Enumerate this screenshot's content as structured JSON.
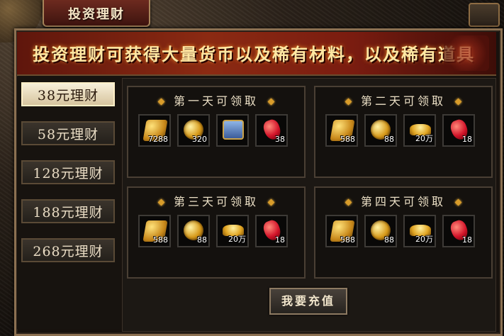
{
  "window": {
    "title": "投资理财"
  },
  "banner": {
    "text": "投资理财可获得大量货币以及稀有材料，以及稀有道具"
  },
  "sidebar": {
    "items": [
      {
        "label": "38元理财",
        "active": true
      },
      {
        "label": "58元理财",
        "active": false
      },
      {
        "label": "128元理财",
        "active": false
      },
      {
        "label": "188元理财",
        "active": false
      },
      {
        "label": "268元理财",
        "active": false
      }
    ]
  },
  "panels": [
    {
      "title": "第一天可领取",
      "items": [
        {
          "icon": "gold-ingot-icon",
          "count": "7288"
        },
        {
          "icon": "gold-coin-icon",
          "count": "320"
        },
        {
          "icon": "treasure-chest-icon",
          "count": ""
        },
        {
          "icon": "red-gem-icon",
          "count": "38"
        }
      ]
    },
    {
      "title": "第二天可领取",
      "items": [
        {
          "icon": "gold-ingot-icon",
          "count": "588"
        },
        {
          "icon": "gold-coin-icon",
          "count": "88"
        },
        {
          "icon": "gold-yuanbao-icon",
          "count": "20万"
        },
        {
          "icon": "red-gem-icon",
          "count": "18"
        }
      ]
    },
    {
      "title": "第三天可领取",
      "items": [
        {
          "icon": "gold-ingot-icon",
          "count": "588"
        },
        {
          "icon": "gold-coin-icon",
          "count": "88"
        },
        {
          "icon": "gold-yuanbao-icon",
          "count": "20万"
        },
        {
          "icon": "red-gem-icon",
          "count": "18"
        }
      ]
    },
    {
      "title": "第四天可领取",
      "items": [
        {
          "icon": "gold-ingot-icon",
          "count": "588"
        },
        {
          "icon": "gold-coin-icon",
          "count": "88"
        },
        {
          "icon": "gold-yuanbao-icon",
          "count": "20万"
        },
        {
          "icon": "red-gem-icon",
          "count": "18"
        }
      ]
    }
  ],
  "actions": {
    "recharge_label": "我要充值"
  },
  "colors": {
    "accent_gold": "#d89c2a",
    "banner_red": "#8b2a12",
    "text_cream": "#ece0c6"
  }
}
